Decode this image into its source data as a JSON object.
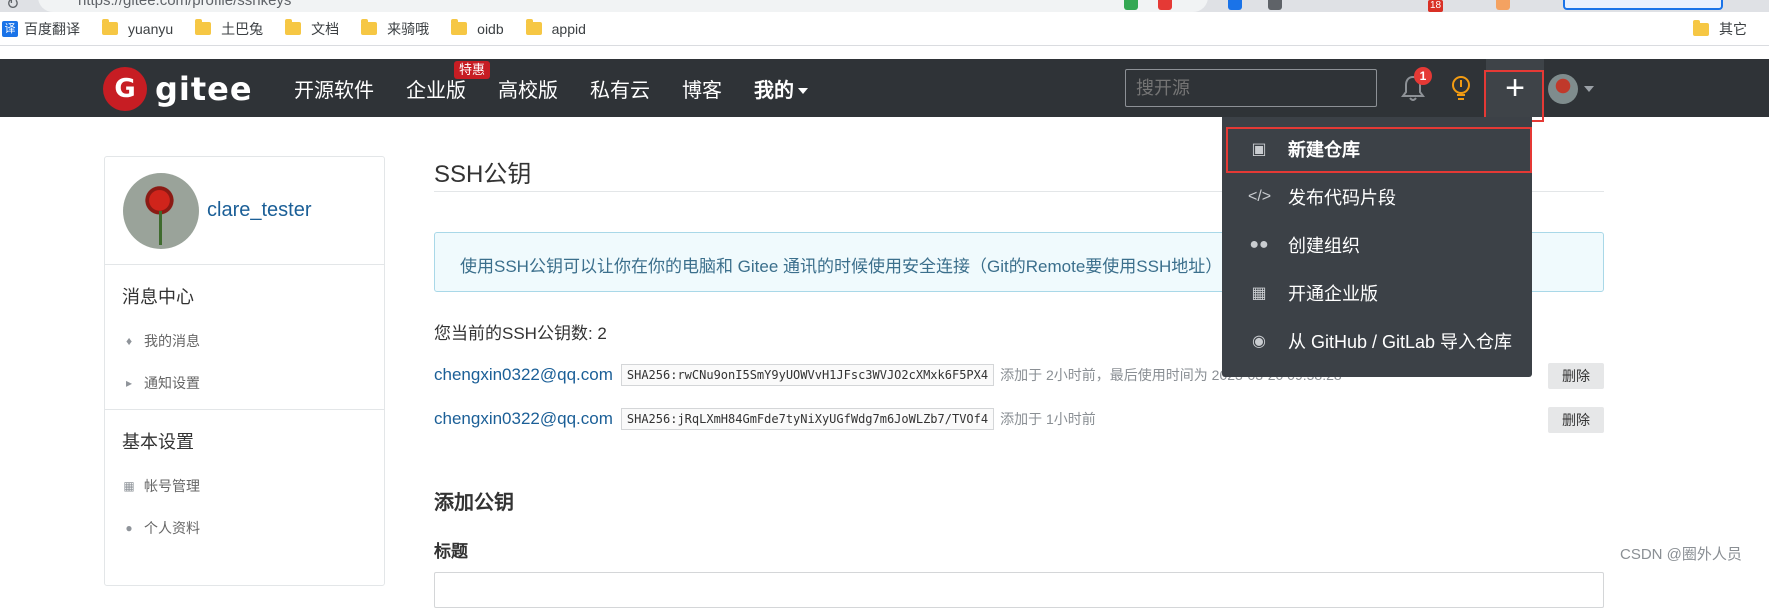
{
  "browser": {
    "url": "https://gitee.com/profile/sshkeys",
    "extension_badge": "18",
    "bookmarks": [
      {
        "label": "百度翻译",
        "type": "translate"
      },
      {
        "label": "yuanyu",
        "type": "folder"
      },
      {
        "label": "土巴兔",
        "type": "folder"
      },
      {
        "label": "文档",
        "type": "folder"
      },
      {
        "label": "来骑哦",
        "type": "folder"
      },
      {
        "label": "oidb",
        "type": "folder"
      },
      {
        "label": "appid",
        "type": "folder"
      }
    ],
    "bookmarks_right": "其它"
  },
  "header": {
    "logo_text": "gitee",
    "logo_letter": "G",
    "nav": [
      {
        "label": "开源软件"
      },
      {
        "label": "企业版",
        "badge": "特惠"
      },
      {
        "label": "高校版"
      },
      {
        "label": "私有云"
      },
      {
        "label": "博客"
      },
      {
        "label": "我的"
      }
    ],
    "search_placeholder": "搜开源",
    "notification_count": "1",
    "plus_symbol": "+"
  },
  "sidebar": {
    "username": "clare_tester",
    "sections": [
      {
        "title": "消息中心",
        "links": [
          {
            "label": "我的消息",
            "icon": "bell-icon"
          },
          {
            "label": "通知设置",
            "icon": "speaker-icon"
          }
        ]
      },
      {
        "title": "基本设置",
        "links": [
          {
            "label": "帐号管理",
            "icon": "id-card-icon"
          },
          {
            "label": "个人资料",
            "icon": "user-icon"
          }
        ]
      }
    ]
  },
  "main": {
    "title": "SSH公钥",
    "info": "使用SSH公钥可以让你在你的电脑和 Gitee 通讯的时候使用安全连接（Git的Remote要使用SSH地址）",
    "count_text": "您当前的SSH公钥数: 2",
    "keys": [
      {
        "email": "chengxin0322@qq.com",
        "fingerprint": "SHA256:rwCNu9onI5SmY9yUOWVvH1JFsc3WVJO2cXMxk6F5PX4",
        "meta": "添加于 2小时前，最后使用时间为 2023-03-20 09:58:28",
        "delete_label": "删除"
      },
      {
        "email": "chengxin0322@qq.com",
        "fingerprint": "SHA256:jRqLXmH84GmFde7tyNiXyUGfWdg7m6JoWLZb7/TVOf4",
        "meta": "添加于 1小时前",
        "delete_label": "删除"
      }
    ],
    "add_title": "添加公钥",
    "field_title_label": "标题"
  },
  "dropdown": {
    "items": [
      {
        "label": "新建仓库",
        "icon": "plus-square-icon"
      },
      {
        "label": "发布代码片段",
        "icon": "code-icon"
      },
      {
        "label": "创建组织",
        "icon": "group-icon"
      },
      {
        "label": "开通企业版",
        "icon": "building-icon"
      },
      {
        "label": "从 GitHub / GitLab 导入仓库",
        "icon": "github-icon"
      }
    ]
  },
  "watermark": "CSDN @圈外人员",
  "colors": {
    "header_bg": "#2f3337",
    "brand_red": "#c71d23",
    "dropdown_bg": "#3c4147",
    "highlight_red": "#e53935",
    "link_blue": "#1b5f97"
  }
}
